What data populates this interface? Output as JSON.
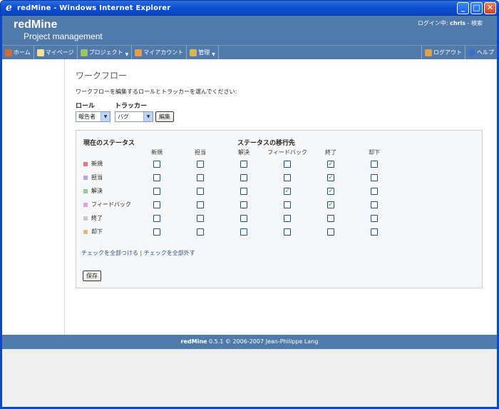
{
  "window": {
    "title": "redMine - Windows Internet Explorer",
    "icon": "ie-icon"
  },
  "header": {
    "brand": "redMine",
    "subtitle": "Project management",
    "logged_prefix": "ログイン中: ",
    "user": "chris",
    "search": " - 検索"
  },
  "menu": {
    "home": "ホーム",
    "mypage": "マイページ",
    "projects": "プロジェクト",
    "myaccount": "マイアカウント",
    "admin": "管理",
    "logout": "ログアウト",
    "help": "ヘルプ"
  },
  "page": {
    "title": "ワークフロー",
    "intro": "ワークフローを編集するロールとトラッカーを選んでください:",
    "role_label": "ロール",
    "role_value": "報告者",
    "tracker_label": "トラッカー",
    "tracker_value": "バグ",
    "edit_button": "編集"
  },
  "workflow": {
    "current_status_header": "現在のステータス",
    "new_status_header": "ステータスの移行先",
    "columns": [
      "新規",
      "担当",
      "解決",
      "フィードバック",
      "終了",
      "却下"
    ],
    "rows": [
      {
        "label": "新規",
        "color": "#e77575",
        "checks": [
          false,
          false,
          false,
          false,
          true,
          false
        ]
      },
      {
        "label": "担当",
        "color": "#b7a6e0",
        "checks": [
          false,
          false,
          false,
          false,
          true,
          false
        ]
      },
      {
        "label": "解決",
        "color": "#8fd08f",
        "checks": [
          false,
          false,
          false,
          true,
          true,
          false
        ]
      },
      {
        "label": "フィードバック",
        "color": "#e0a0e8",
        "checks": [
          false,
          false,
          false,
          false,
          true,
          false
        ]
      },
      {
        "label": "終了",
        "color": "#c8c8c8",
        "checks": [
          false,
          false,
          false,
          false,
          false,
          false
        ]
      },
      {
        "label": "却下",
        "color": "#e8b878",
        "checks": [
          false,
          false,
          false,
          false,
          false,
          false
        ]
      }
    ],
    "check_all": "チェックを全部つける",
    "separator": "|",
    "uncheck_all": "チェックを全部外す",
    "save_button": "保存"
  },
  "footer": {
    "brand": "redMine",
    "text": " 0.5.1 © 2006-2007 Jean-Philippe Lang"
  }
}
